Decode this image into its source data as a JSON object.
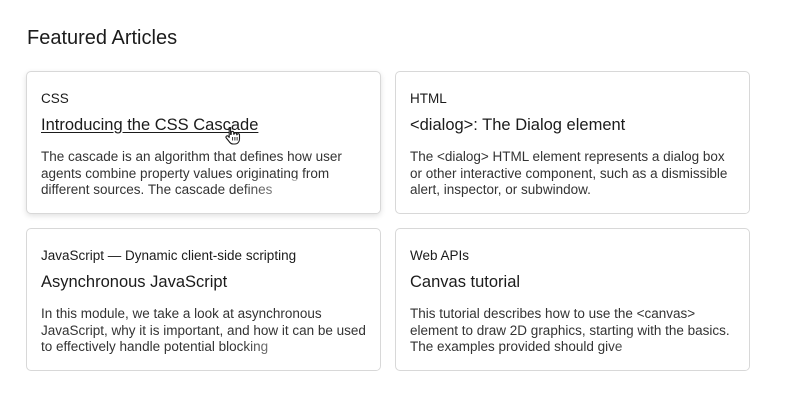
{
  "section": {
    "title": "Featured Articles"
  },
  "cards": [
    {
      "category": "CSS",
      "title": "Introducing the CSS Cascade",
      "description": "The cascade is an algorithm that defines how user agents combine property values originating from different sources. The cascade defines"
    },
    {
      "category": "HTML",
      "title": "<dialog>: The Dialog element",
      "description": "The <dialog> HTML element represents a dialog box or other interactive component, such as a dismissible alert, inspector, or subwindow."
    },
    {
      "category": "JavaScript — Dynamic client-side scripting",
      "title": "Asynchronous JavaScript",
      "description": "In this module, we take a look at asynchronous JavaScript, why it is important, and how it can be used to effectively handle potential blocking"
    },
    {
      "category": "Web APIs",
      "title": "Canvas tutorial",
      "description": "This tutorial describes how to use the <canvas> element to draw 2D graphics, starting with the basics. The examples provided should give"
    }
  ],
  "cursor": {
    "icon": "hand-pointer-icon"
  }
}
